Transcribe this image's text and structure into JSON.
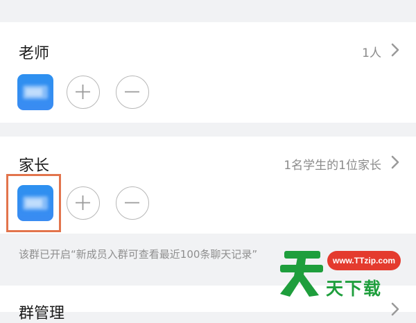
{
  "teacher_section": {
    "title": "老师",
    "summary": "1人"
  },
  "parent_section": {
    "title": "家长",
    "summary": "1名学生的1位家长"
  },
  "notice": "该群已开启“新成员入群可查看最近100条聊天记录”",
  "manage_section": {
    "title": "群管理"
  },
  "watermark": {
    "url": "www.TTzip.com",
    "brand": "天下载",
    "colors": {
      "green": "#1e9e3c",
      "red": "#e43b2e"
    }
  },
  "colors": {
    "background": "#f1f2f4",
    "avatar_blue": "#3a8cf2",
    "highlight": "#e2744c"
  },
  "icons": {
    "chevron": "chevron-right-icon",
    "add": "plus-icon",
    "remove": "minus-icon"
  }
}
